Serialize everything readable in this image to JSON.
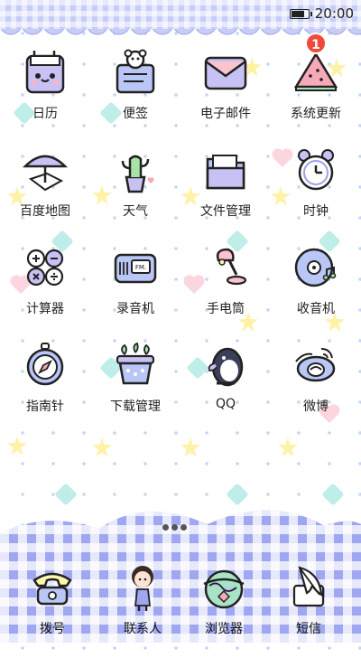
{
  "status_bar": {
    "time": "20:00",
    "battery_level": 0.85
  },
  "apps": [
    {
      "label": "日历",
      "icon": "calendar-bag-icon"
    },
    {
      "label": "便签",
      "icon": "notes-bear-icon"
    },
    {
      "label": "电子邮件",
      "icon": "envelope-icon"
    },
    {
      "label": "系统更新",
      "icon": "watermelon-icon",
      "badge": "1"
    },
    {
      "label": "百度地图",
      "icon": "umbrella-map-icon"
    },
    {
      "label": "天气",
      "icon": "cactus-icon"
    },
    {
      "label": "文件管理",
      "icon": "folder-icon"
    },
    {
      "label": "时钟",
      "icon": "alarm-clock-icon"
    },
    {
      "label": "计算器",
      "icon": "calculator-icon"
    },
    {
      "label": "录音机",
      "icon": "radio-fm-icon"
    },
    {
      "label": "手电筒",
      "icon": "desk-lamp-icon"
    },
    {
      "label": "收音机",
      "icon": "vinyl-disc-icon"
    },
    {
      "label": "指南针",
      "icon": "compass-icon"
    },
    {
      "label": "下载管理",
      "icon": "plant-pot-icon"
    },
    {
      "label": "QQ",
      "icon": "penguin-icon"
    },
    {
      "label": "微博",
      "icon": "weibo-eye-icon"
    }
  ],
  "dock": [
    {
      "label": "拨号",
      "icon": "telephone-icon"
    },
    {
      "label": "联系人",
      "icon": "girl-contact-icon"
    },
    {
      "label": "浏览器",
      "icon": "globe-icon"
    },
    {
      "label": "短信",
      "icon": "feather-letter-icon"
    }
  ],
  "colors": {
    "accent": "#9ea7ef",
    "badge": "#f04a3a",
    "outline": "#222222"
  }
}
